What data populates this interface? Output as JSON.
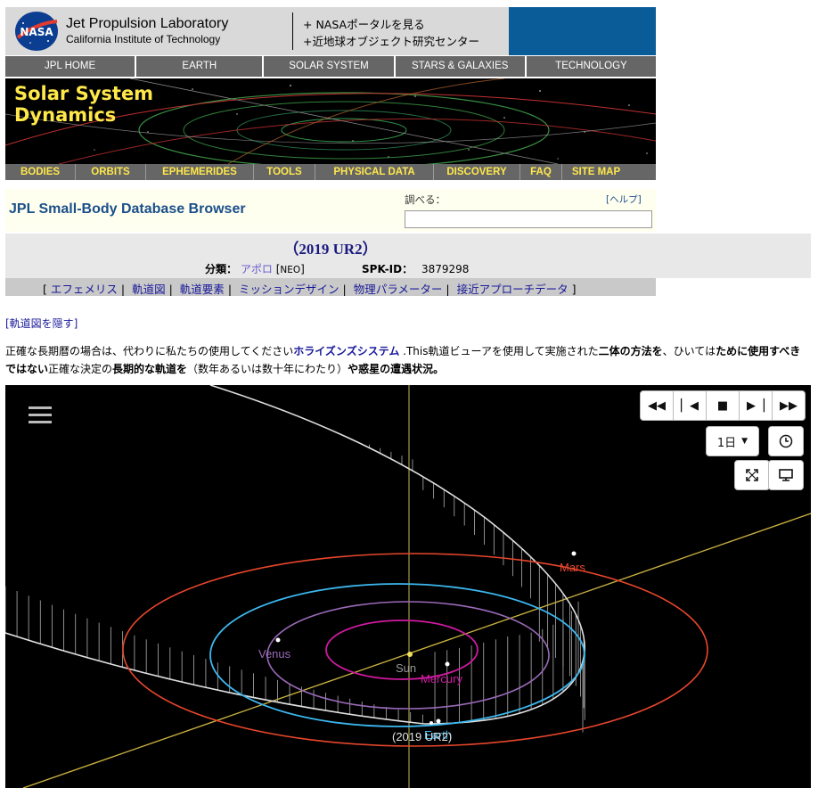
{
  "header": {
    "logo_text": "NASA",
    "title": "Jet Propulsion Laboratory",
    "subtitle": "California Institute of Technology",
    "link1": "+ NASAポータルを見る",
    "link2": "+近地球オブジェクト研究センター"
  },
  "topnav": [
    "JPL HOME",
    "EARTH",
    "SOLAR SYSTEM",
    "STARS & GALAXIES",
    "TECHNOLOGY"
  ],
  "banner": {
    "line1": "Solar System",
    "line2": "Dynamics"
  },
  "subnav": [
    "BODIES",
    "ORBITS",
    "EPHEMERIDES",
    "TOOLS",
    "PHYSICAL DATA",
    "DISCOVERY",
    "FAQ",
    "SITE MAP"
  ],
  "sbdb": {
    "title": "JPL Small-Body Database Browser",
    "search_label": "調べる：",
    "help_link": "[ヘルプ]",
    "search_value": ""
  },
  "object": {
    "name": "（2019 UR2）",
    "class_label": "分類：",
    "class_value": "アポロ",
    "class_code": "NEO",
    "spk_label": "SPK-ID：",
    "spk_value": "3879298"
  },
  "tabs": [
    "エフェメリス",
    "軌道図",
    "軌道要素",
    "ミッションデザイン",
    "物理パラメーター",
    "接近アプローチデータ"
  ],
  "hide_link": "[軌道図を隠す]",
  "note": {
    "p1": "正確な長期暦の場合は、代わりに私たちの使用してください",
    "p2": "ホライズンズシステム",
    "p3": " .This軌道ビューアを使用して実施された",
    "p4": "二体の方法を",
    "p5": "、ひいては",
    "p6": "ために使用すべきではない",
    "p7": "正確な決定の",
    "p8": "長期的な軌道を",
    "p9": "（数年あるいは数十年にわたり）",
    "p10": "や惑星の遭遇状況。"
  },
  "viewer": {
    "step_label": "1日",
    "labels": {
      "mars": "Mars",
      "venus": "Venus",
      "sun": "Sun",
      "mercury": "Mercury",
      "earth": "Earth",
      "object": "(2019 UR2)"
    },
    "colors": {
      "mars": "#e8462c",
      "earth": "#3cb8f0",
      "venus": "#9a6ab8",
      "mercury": "#d01aa0",
      "sun": "#f0e060",
      "object": "#d8d8d8"
    }
  }
}
